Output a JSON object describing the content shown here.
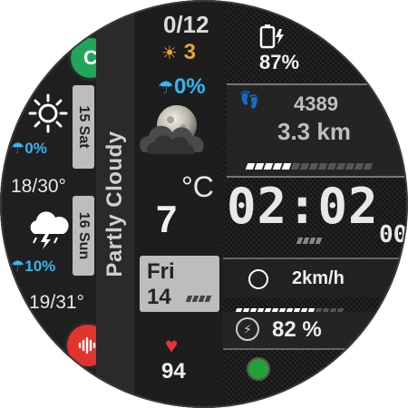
{
  "left_forecast": {
    "day1": {
      "date_label": "15 Sat",
      "precip": "0%",
      "temps": "18/30°",
      "icon": "sun-icon"
    },
    "day2": {
      "date_label": "16 Sun",
      "precip": "10%",
      "temps": "19/31°",
      "icon": "thunderstorm-cloud-icon"
    }
  },
  "center": {
    "moon_phase": "0/12",
    "uv_index": "3",
    "precip_chance": "0%",
    "condition": "Partly Cloudy",
    "temperature": "7",
    "temp_unit": "°C",
    "weekday": "Fri",
    "day_number": "14",
    "heart_rate": "94"
  },
  "right": {
    "battery": "87%",
    "steps": "4389",
    "distance": "3.3 km",
    "time": "02:02",
    "seconds": "00",
    "speed": "2km/h",
    "energy": "82 %"
  },
  "colors": {
    "accent_blue": "#34b6f0",
    "accent_orange": "#e9a43c",
    "heart_red": "#e8353a",
    "shortcut_green": "#1fa65a",
    "shortcut_red": "#e2332e"
  }
}
